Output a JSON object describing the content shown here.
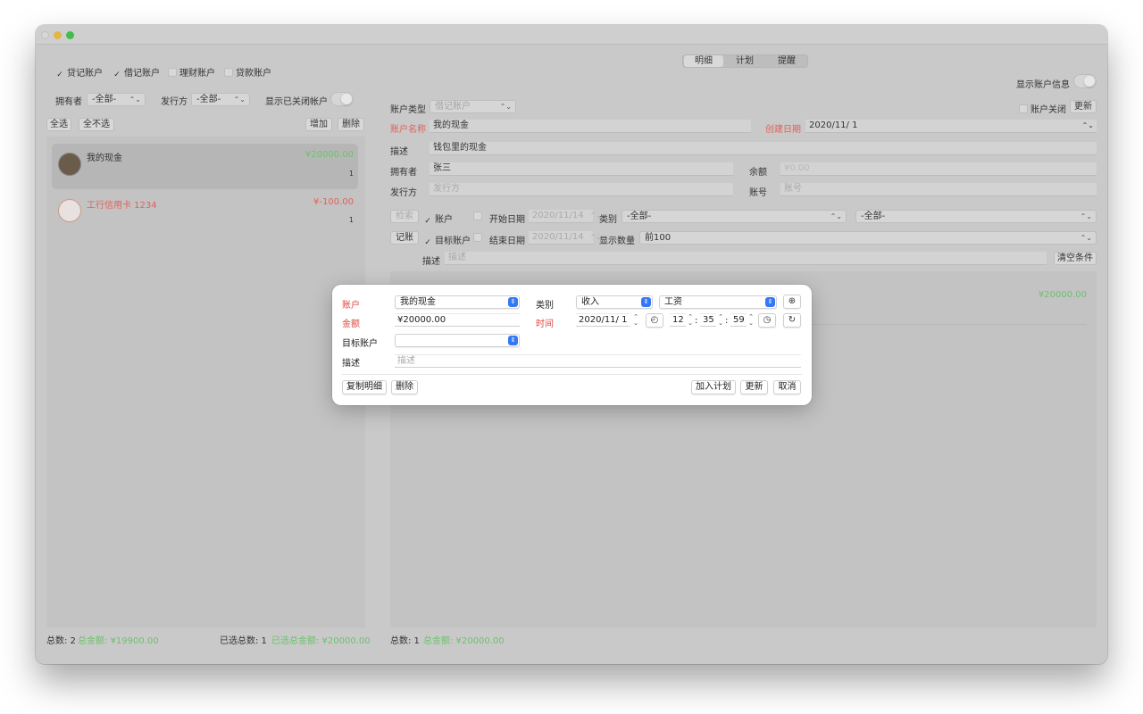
{
  "left": {
    "filters": [
      {
        "label": "贷记账户",
        "checked": true
      },
      {
        "label": "借记账户",
        "checked": true
      },
      {
        "label": "理财账户",
        "checked": false
      },
      {
        "label": "贷款账户",
        "checked": false
      }
    ],
    "owner_label": "拥有者",
    "owner_value": "-全部-",
    "issuer_label": "发行方",
    "issuer_value": "-全部-",
    "show_closed_label": "显示已关闭帐户",
    "select_all": "全选",
    "select_none": "全不选",
    "add": "增加",
    "delete": "删除",
    "accounts": [
      {
        "name": "我的现金",
        "amount": "¥20000.00",
        "count": "1"
      },
      {
        "name": "工行信用卡 1234",
        "amount": "¥-100.00",
        "count": "1"
      }
    ],
    "footer_total": "总数: 2",
    "footer_total_amount": "总金额: ¥19900.00",
    "footer_selected": "已选总数: 1",
    "footer_selected_amount": "已选总金额: ¥20000.00"
  },
  "right": {
    "tabs": [
      "明细",
      "计划",
      "提醒"
    ],
    "show_account_info": "显示账户信息",
    "account_type_label": "账户类型",
    "account_type_value": "借记账户",
    "account_closed_label": "账户关闭",
    "update_btn": "更新",
    "account_name_label": "账户名称",
    "account_name_value": "我的现金",
    "created_label": "创建日期",
    "created_value": "2020/11/  1",
    "desc_label": "描述",
    "desc_value": "钱包里的现金",
    "owner_label": "拥有者",
    "owner_value": "张三",
    "balance_label": "余额",
    "balance_value": "¥0.00",
    "issuer_label": "发行方",
    "issuer_placeholder": "发行方",
    "account_no_label": "账号",
    "account_no_placeholder": "账号",
    "search_btn": "检索",
    "account_chk": "账户",
    "start_date_label": "开始日期",
    "start_date_value": "2020/11/14",
    "category_label": "类别",
    "category_value": "-全部-",
    "category2_value": "-全部-",
    "post_btn": "记账",
    "target_chk": "目标账户",
    "end_date_label": "结束日期",
    "end_date_value": "2020/11/14",
    "display_count_label": "显示数量",
    "display_count_value": "前100",
    "filter_desc_label": "描述",
    "filter_desc_placeholder": "描述",
    "clear_btn": "清空条件",
    "list_amount": "¥20000.00",
    "footer_total": "总数: 1",
    "footer_total_amount": "总金额: ¥20000.00"
  },
  "dialog": {
    "account_label": "账户",
    "account_value": "我的现金",
    "category_label": "类别",
    "category_value": "收入",
    "subcategory_value": "工资",
    "amount_label": "金额",
    "amount_value": "¥20000.00",
    "time_label": "时间",
    "date_value": "2020/11/  1",
    "hour": "12",
    "minute": "35",
    "second": "59",
    "target_label": "目标账户",
    "target_value": "",
    "desc_label": "描述",
    "desc_placeholder": "描述",
    "copy_btn": "复制明细",
    "delete_btn": "删除",
    "add_plan_btn": "加入计划",
    "update_btn": "更新",
    "cancel_btn": "取消"
  }
}
